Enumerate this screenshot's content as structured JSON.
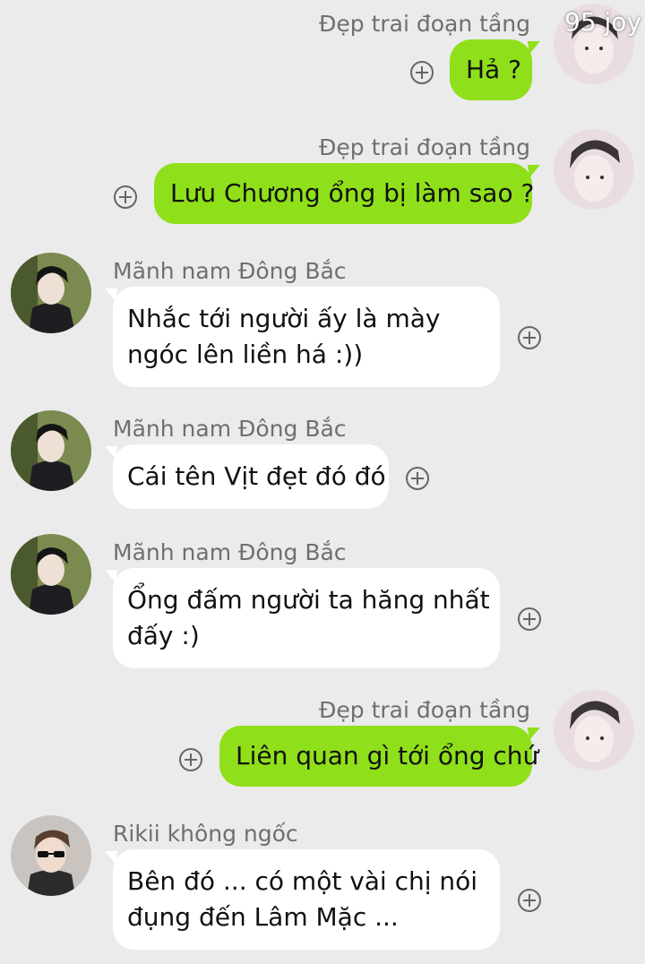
{
  "watermark": "95 joy",
  "colors": {
    "background": "#ebebeb",
    "outgoing_bubble": "#8fe01a",
    "incoming_bubble": "#ffffff",
    "sender_name": "#6f6f6f"
  },
  "messages": [
    {
      "direction": "outgoing",
      "sender": "Đẹp trai đoạn tầng",
      "lines": [
        "Hả ?"
      ]
    },
    {
      "direction": "outgoing",
      "sender": "Đẹp trai đoạn tầng",
      "lines": [
        "Lưu Chương ổng bị làm sao ?"
      ]
    },
    {
      "direction": "incoming",
      "sender": "Mãnh nam Đông Bắc",
      "lines": [
        "Nhắc tới người ấy là mày",
        "ngóc lên liền há :))"
      ]
    },
    {
      "direction": "incoming",
      "sender": "Mãnh nam Đông Bắc",
      "lines": [
        "Cái tên Vịt đẹt đó đó"
      ]
    },
    {
      "direction": "incoming",
      "sender": "Mãnh nam Đông Bắc",
      "lines": [
        "Ổng đấm người ta hăng nhất",
        "đấy :)"
      ]
    },
    {
      "direction": "outgoing",
      "sender": "Đẹp trai đoạn tầng",
      "lines": [
        "Liên quan gì tới ổng chứ"
      ]
    },
    {
      "direction": "incoming",
      "sender": "Rikii không ngốc",
      "lines": [
        "Bên đó ... có một vài chị nói",
        "đụng đến Lâm Mặc ..."
      ]
    }
  ]
}
